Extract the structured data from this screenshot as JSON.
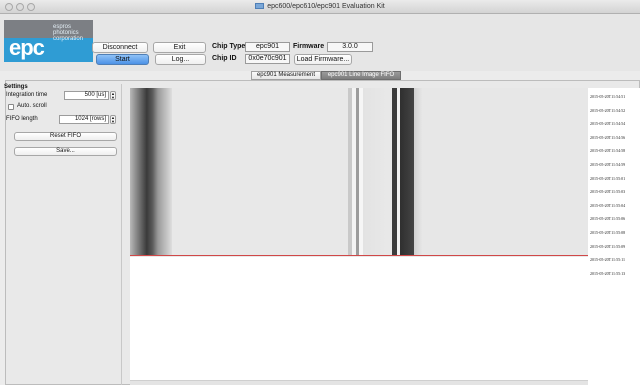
{
  "window": {
    "title": "epc600/epc610/epc901 Evaluation Kit",
    "app_icon": "window-app-icon"
  },
  "logo": {
    "text": "epc",
    "sub_line1": "espros",
    "sub_line2": "photonics",
    "sub_line3": "corporation",
    "color_blue": "#2f9cd4",
    "color_gray": "#7c7f84"
  },
  "toolbar": {
    "disconnect_label": "Disconnect",
    "exit_label": "Exit",
    "start_label": "Start",
    "log_label": "Log...",
    "chip_type_label": "Chip Type",
    "chip_type_value": "epc901",
    "firmware_label": "Firmware",
    "firmware_value": "3.0.0",
    "chip_id_label": "Chip ID",
    "chip_id_value": "0x0e70c901",
    "load_firmware_label": "Load Firmware..."
  },
  "tabs": [
    {
      "label": "epc901 Measurement",
      "active": false
    },
    {
      "label": "epc901 Line Image FIFO",
      "active": true
    }
  ],
  "settings": {
    "title": "Settings",
    "integration_time_label": "Integration time",
    "integration_time_value": "500 [us]",
    "auto_scroll_label": "Auto. scroll",
    "auto_scroll_checked": false,
    "fifo_length_label": "FIFO length",
    "fifo_length_value": "1024 [rows]",
    "reset_fifo_label": "Reset FIFO",
    "save_label": "Save..."
  },
  "timestamps": [
    "2015-05-20T11:54:51",
    "2015-05-20T11:54:52",
    "2015-05-20T11:54:54",
    "2015-05-20T11:54:56",
    "2015-05-20T11:54:58",
    "2015-05-20T11:54:59",
    "2015-05-20T11:55:01",
    "2015-05-20T11:55:03",
    "2015-05-20T11:55:04",
    "2015-05-20T11:55:06",
    "2015-05-20T11:55:08",
    "2015-05-20T11:55:09",
    "2015-05-20T11:55:11",
    "2015-05-20T11:55:13"
  ],
  "colors": {
    "accent_blue": "#4c92e6",
    "active_tab": "#8a8a8a",
    "image_baseline": "#d04848"
  }
}
